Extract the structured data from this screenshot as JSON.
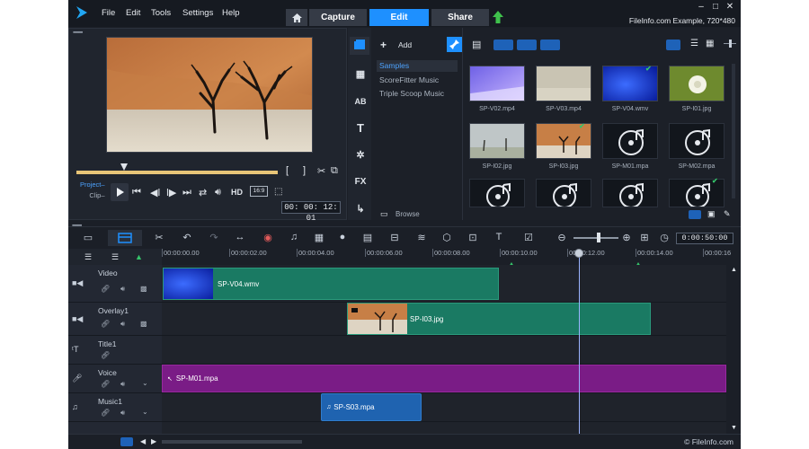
{
  "colors": {
    "accent": "#1e90ff",
    "clip_green": "#1a7a63",
    "clip_purple": "#7a1c86",
    "clip_blue": "#1f63b0",
    "marker": "#35c46a",
    "scrub_range": "#e7c477"
  },
  "menu": [
    "File",
    "Edit",
    "Tools",
    "Settings",
    "Help"
  ],
  "workspace_tabs": [
    {
      "label": "Capture"
    },
    {
      "label": "Edit",
      "active": true
    },
    {
      "label": "Share"
    }
  ],
  "project_info": "FileInfo.com Example, 720*480",
  "player": {
    "project_label": "Project–",
    "clip_label": "Clip–",
    "hd_label": "HD",
    "aspect": "16:9",
    "timecode": "00: 00: 12: 01"
  },
  "library": {
    "add_label": "Add",
    "browse_label": "Browse",
    "categories": [
      "Samples",
      "ScoreFitter Music",
      "Triple Scoop Music"
    ],
    "items": [
      {
        "label": "SP-V02.mp4",
        "icon": "video-thumb",
        "checked": false
      },
      {
        "label": "SP-V03.mp4",
        "icon": "video-thumb",
        "checked": false
      },
      {
        "label": "SP-V04.wmv",
        "icon": "video-thumb",
        "checked": true
      },
      {
        "label": "SP-I01.jpg",
        "icon": "image-thumb",
        "checked": false
      },
      {
        "label": "SP-I02.jpg",
        "icon": "image-thumb",
        "checked": false
      },
      {
        "label": "SP-I03.jpg",
        "icon": "image-thumb",
        "checked": true
      },
      {
        "label": "SP-M01.mpa",
        "icon": "music-disc-icon",
        "checked": false
      },
      {
        "label": "SP-M02.mpa",
        "icon": "music-disc-icon",
        "checked": false
      },
      {
        "label": "",
        "icon": "music-disc-icon",
        "checked": false
      },
      {
        "label": "",
        "icon": "music-disc-icon",
        "checked": false
      },
      {
        "label": "",
        "icon": "music-disc-icon",
        "checked": false
      },
      {
        "label": "",
        "icon": "music-disc-icon",
        "checked": true
      }
    ]
  },
  "timeline": {
    "timecode": "0:00:50:00",
    "ruler_labels": [
      "00:00:00.00",
      "00:00:02.00",
      "00:00:04.00",
      "00:00:06.00",
      "00:00:08.00",
      "00:00:10.00",
      "00:00:12.00",
      "00:00:14.00",
      "00:00:16"
    ],
    "tracks": [
      {
        "name": "Video",
        "clips": [
          {
            "label": "SP-V04.wmv"
          }
        ]
      },
      {
        "name": "Overlay1",
        "clips": [
          {
            "label": "SP-I03.jpg"
          }
        ]
      },
      {
        "name": "Title1",
        "clips": []
      },
      {
        "name": "Voice",
        "clips": [
          {
            "label": "SP-M01.mpa"
          }
        ]
      },
      {
        "name": "Music1",
        "clips": [
          {
            "label": "SP-S03.mpa"
          }
        ]
      }
    ]
  },
  "watermark": "© FileInfo.com"
}
